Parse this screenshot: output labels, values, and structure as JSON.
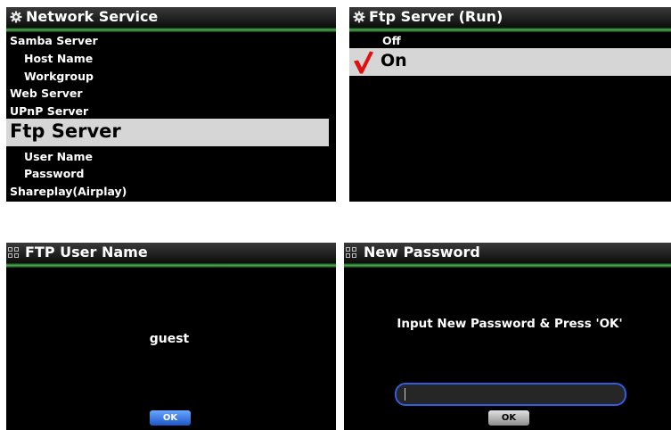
{
  "network_service": {
    "title": "Network Service",
    "title_icon": "gear-icon",
    "items": [
      {
        "label": "Samba Server"
      },
      {
        "label": "Host Name"
      },
      {
        "label": "Workgroup"
      },
      {
        "label": "Web Server"
      },
      {
        "label": "UPnP Server"
      },
      {
        "label": "Ftp Server",
        "selected": true
      },
      {
        "label": "User Name"
      },
      {
        "label": "Password"
      },
      {
        "label": "Shareplay(Airplay)"
      }
    ]
  },
  "ftp_server": {
    "title": "Ftp Server (Run)",
    "title_icon": "gear-icon",
    "options": [
      {
        "label": "Off"
      },
      {
        "label": "On",
        "selected": true,
        "check_icon": "checkmark-icon"
      }
    ]
  },
  "ftp_user_name": {
    "title": "FTP User Name",
    "title_icon": "grid-icon",
    "value": "guest",
    "ok_label": "OK"
  },
  "new_password": {
    "title": "New Password",
    "title_icon": "grid-icon",
    "prompt": "Input New Password & Press 'OK'",
    "input_value": "",
    "ok_label": "OK"
  },
  "colors": {
    "panel_bg": "#000000",
    "title_green": "#4fb04f",
    "selection_bg": "#d6d6d6",
    "check_red": "#e01010",
    "input_border": "#2f5fe0",
    "ok_blue": "#1c57c7"
  }
}
